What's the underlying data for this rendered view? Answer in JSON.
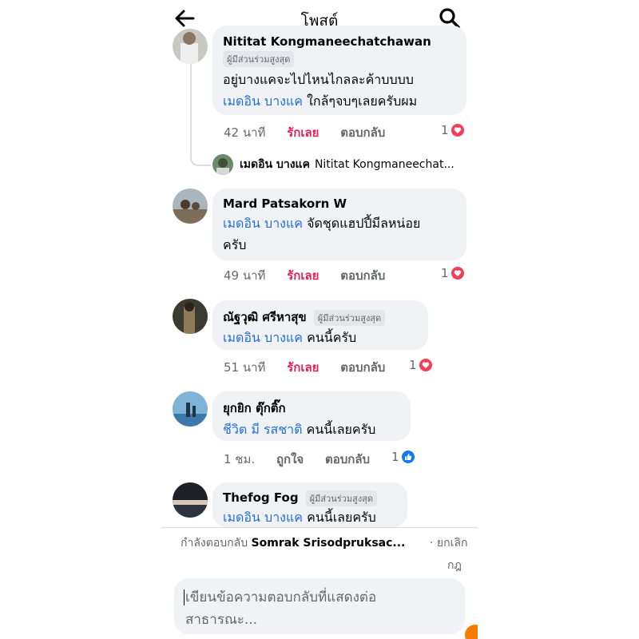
{
  "header": {
    "title": "โพสต์",
    "back_icon": "arrow-left-icon",
    "search_icon": "search-icon"
  },
  "colors": {
    "link": "#216fdb",
    "love": "#e0245e",
    "muted": "#65676b",
    "bubble": "#f0f2f5",
    "heart": "#f33e58",
    "like": "#1877f2"
  },
  "comments": [
    {
      "name": "Nititat Kongmaneechatchawan",
      "badge": "ผู้มีส่วนร่วมสูงสุด",
      "line1": "อยู่บางแคจะไปไหนไกลละค้าบบบบ",
      "mention": "เมดอิน บางแค",
      "line2": "ใกล้ๆจบๆเลยครับผม",
      "time": "42 นาที",
      "love_label": "รักเลย",
      "reply_label": "ตอบกลับ",
      "reaction_count": "1",
      "reaction_type": "heart-icon"
    },
    {
      "name": "Mard Patsakorn W",
      "mention": "เมดอิน บางแค",
      "line1": "จัดชุดแฮปปี้มีลหน่อย",
      "line2": "ครับ",
      "time": "49 นาที",
      "love_label": "รักเลย",
      "reply_label": "ตอบกลับ",
      "reaction_count": "1",
      "reaction_type": "heart-icon"
    },
    {
      "name": "ณัฐวุฒิ ศรีหาสุข",
      "badge": "ผู้มีส่วนร่วมสูงสุด",
      "mention": "เมดอิน บางแค",
      "line1": "คนนี้ครับ",
      "time": "51 นาที",
      "love_label": "รักเลย",
      "reply_label": "ตอบกลับ",
      "reaction_count": "1",
      "reaction_type": "heart-icon"
    },
    {
      "name": "ยุกยิก ตุ๊กติ๊ก",
      "mention": "ชีวิต มี รสชาติ",
      "line1": "คนนี้เลยครับ",
      "time": "1 ชม.",
      "like_label": "ถูกใจ",
      "reply_label": "ตอบกลับ",
      "reaction_count": "1",
      "reaction_type": "like-icon"
    },
    {
      "name": "Thefog Fog",
      "badge": "ผู้มีส่วนร่วมสูงสุด",
      "mention": "เมดอิน บางแค",
      "line1": "คนนี้เลยครับ"
    }
  ],
  "thread_reply": {
    "name": "เมดอิน บางแค",
    "preview": "Nititat Kongmaneechat..."
  },
  "composer": {
    "replying_prefix": "กำลังตอบกลับ",
    "replying_name": "Somrak Srisodpruksac...",
    "cancel_label_1": "· ยกเลิก",
    "cancel_label_2": "กฎ",
    "placeholder": "เขียนข้อความตอบกลับที่แสดงต่อสาธารณะ..."
  }
}
